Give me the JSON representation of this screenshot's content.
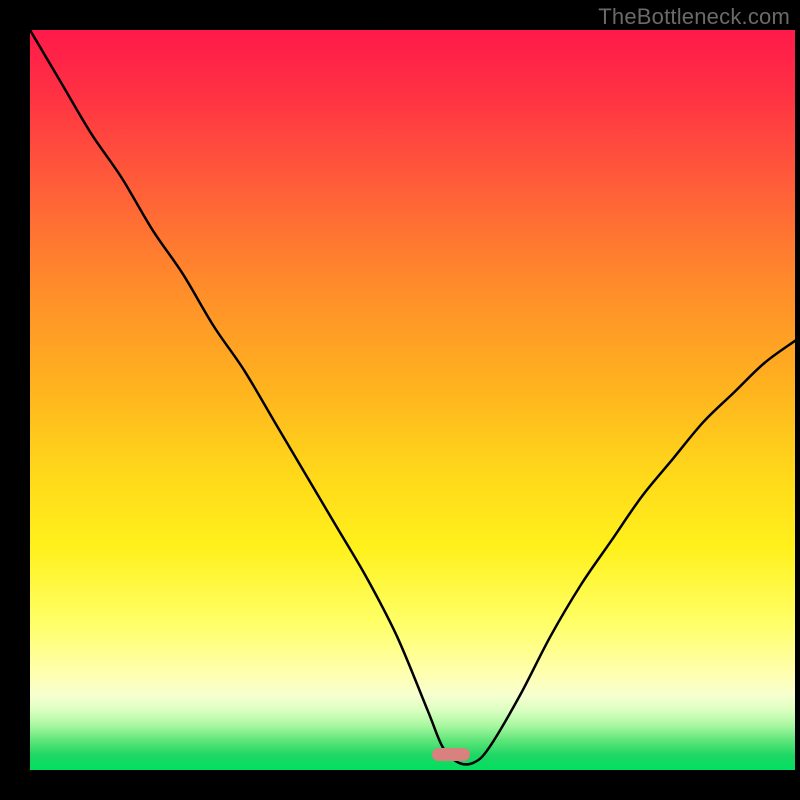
{
  "watermark": "TheBottleneck.com",
  "chart_data": {
    "type": "line",
    "title": "",
    "xlabel": "",
    "ylabel": "",
    "xlim": [
      0,
      100
    ],
    "ylim": [
      0,
      100
    ],
    "grid": false,
    "legend": false,
    "background_gradient": {
      "top": "#ff1a4a",
      "mid_upper": "#ff8a2b",
      "mid": "#fff11c",
      "mid_lower": "#ffffb0",
      "bottom": "#00e060"
    },
    "series": [
      {
        "name": "bottleneck-curve",
        "color": "#000000",
        "x": [
          0,
          4,
          8,
          12,
          16,
          20,
          24,
          28,
          32,
          36,
          40,
          44,
          48,
          52,
          54,
          56,
          58,
          60,
          64,
          68,
          72,
          76,
          80,
          84,
          88,
          92,
          96,
          100
        ],
        "y": [
          100,
          93,
          86,
          80,
          73,
          67,
          60,
          54,
          47,
          40,
          33,
          26,
          18,
          8,
          3,
          1,
          1,
          3,
          10,
          18,
          25,
          31,
          37,
          42,
          47,
          51,
          55,
          58
        ]
      }
    ],
    "annotations": [
      {
        "name": "valley-marker",
        "shape": "rounded-rect",
        "color": "#d9817e",
        "x": 55,
        "y": 1,
        "width_pct": 5,
        "height_pct": 1.8
      }
    ]
  }
}
